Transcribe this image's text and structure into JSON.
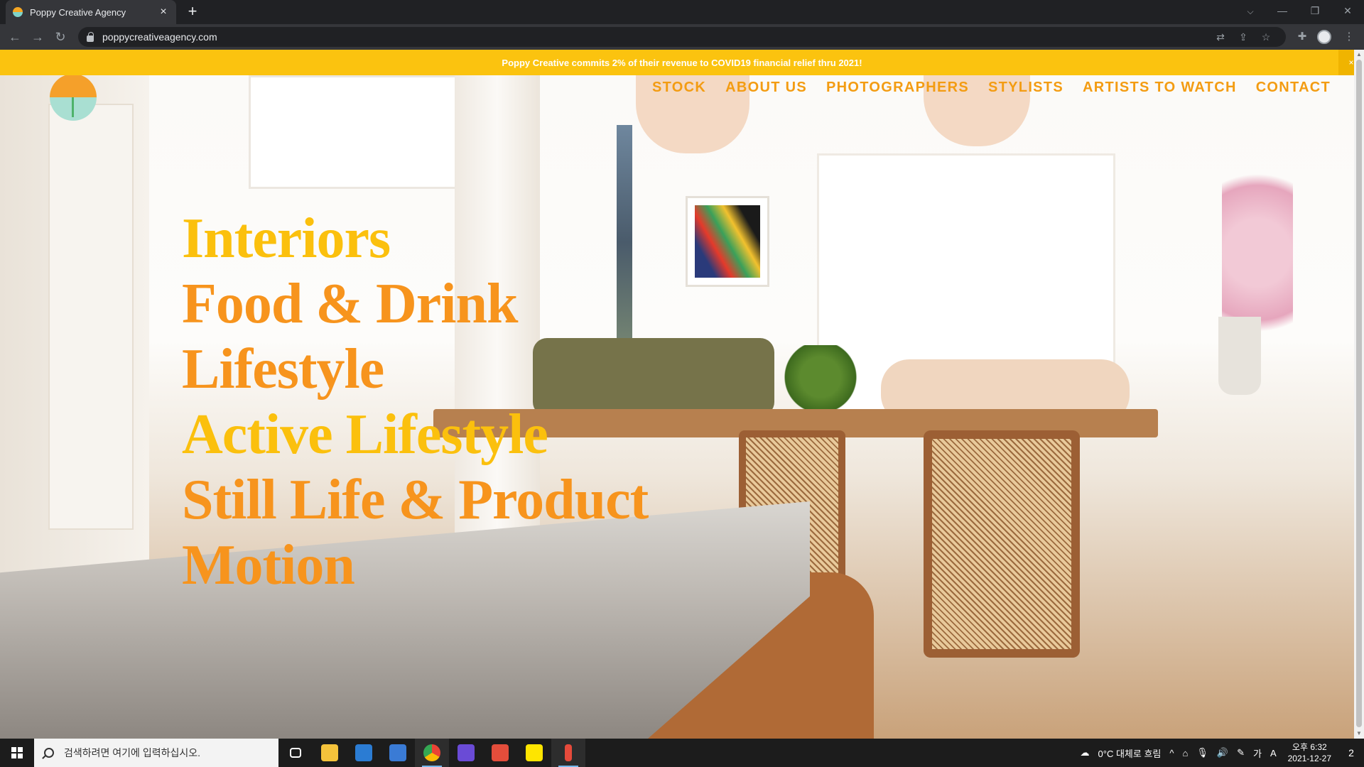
{
  "browser": {
    "tab": {
      "title": "Poppy Creative Agency",
      "close": "×"
    },
    "new_tab": "+",
    "url": "poppycreativeagency.com",
    "window_controls": {
      "tab_search": "⌵",
      "minimize": "—",
      "restore": "❐",
      "close": "✕"
    },
    "nav": {
      "back": "←",
      "forward": "→",
      "reload": "↻"
    },
    "omnibox_icons": {
      "translate": "⇄",
      "share": "⇪",
      "bookmark": "☆"
    },
    "extensions": "✚",
    "menu": "⋮"
  },
  "announcement": {
    "message": "Poppy Creative commits 2% of their revenue to COVID19 financial relief thru 2021!",
    "close": "×"
  },
  "site": {
    "nav": [
      "STOCK",
      "ABOUT US",
      "PHOTOGRAPHERS",
      "STYLISTS",
      "ARTISTS TO WATCH",
      "CONTACT"
    ],
    "categories": [
      "Interiors",
      "Food & Drink",
      "Lifestyle",
      "Active Lifestyle",
      "Still Life & Product",
      "Motion"
    ]
  },
  "colors": {
    "accent": "#f39c12",
    "banner": "#fbc30f"
  },
  "taskbar": {
    "search_placeholder": "검색하려면 여기에 입력하십시오.",
    "weather": "0°C  대체로 흐림",
    "tray": {
      "up": "^",
      "network": "⌂",
      "mic": "🎙",
      "volume": "🔊",
      "pen": "✎",
      "ime": "가",
      "input": "A"
    },
    "time": "오후 6:32",
    "date": "2021-12-27",
    "notifications": "2"
  }
}
